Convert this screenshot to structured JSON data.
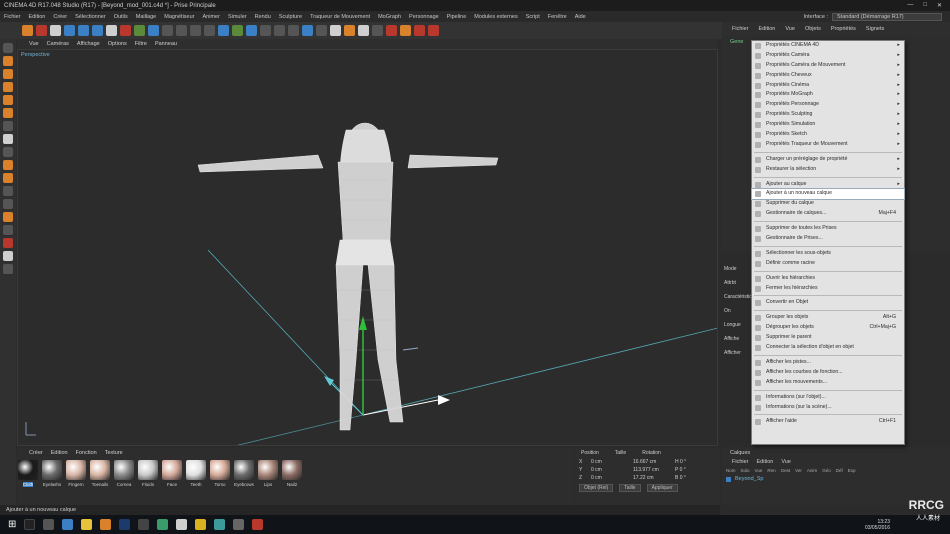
{
  "titlebar": {
    "title": "CINEMA 4D R17.048 Studio (R17) - [Beyond_mod_001.c4d *] - Prise Principale"
  },
  "menubar": {
    "items": [
      "Fichier",
      "Edition",
      "Créer",
      "Sélectionner",
      "Outils",
      "Maillage",
      "Magnétiseur",
      "Animer",
      "Simuler",
      "Rendu",
      "Sculpture",
      "Traqueur de Mouvement",
      "MoGraph",
      "Personnage",
      "Pipeline",
      "Modules externes",
      "Script",
      "Fenêtre",
      "Aide"
    ],
    "interface_label": "Interface :",
    "interface_value": "Standard (Démarrage R17)"
  },
  "viewport": {
    "menu": [
      "Vue",
      "Caméras",
      "Affichage",
      "Options",
      "Filtre",
      "Panneau"
    ],
    "label": "Perspective"
  },
  "materials": {
    "menu": [
      "Créer",
      "Edition",
      "Fonction",
      "Texture"
    ],
    "items": [
      {
        "label": "Cloth",
        "color": "#1a1a1a"
      },
      {
        "label": "Eyelashs",
        "color": "#6a6a6a"
      },
      {
        "label": "Fingern",
        "color": "#d8b6a6"
      },
      {
        "label": "Toenails",
        "color": "#d9b5a4"
      },
      {
        "label": "Cornea",
        "color": "#8a8a8a"
      },
      {
        "label": "Fluids",
        "color": "#c9c9c9"
      },
      {
        "label": "Face",
        "color": "#d4a89a"
      },
      {
        "label": "Teeth",
        "color": "#e0e0e0"
      },
      {
        "label": "Torso",
        "color": "#d6a998"
      },
      {
        "label": "Eyebrows",
        "color": "#6b6b6b"
      },
      {
        "label": "Lips",
        "color": "#a9877a"
      },
      {
        "label": "Nail2",
        "color": "#8c6b64"
      }
    ]
  },
  "coords": {
    "headers": [
      "Position",
      "Taille",
      "Rotation"
    ],
    "rows": [
      {
        "axis": "X",
        "pos": "0 cm",
        "size": "16.667 cm",
        "rot": "H 0 °"
      },
      {
        "axis": "Y",
        "pos": "0 cm",
        "size": "113.977 cm",
        "rot": "P 0 °"
      },
      {
        "axis": "Z",
        "pos": "0 cm",
        "size": "17.22 cm",
        "rot": "B 0 °"
      }
    ],
    "mode_select": "Objet (Rel)",
    "size_select": "Taille",
    "apply": "Appliquer"
  },
  "status": {
    "text": "Ajouter à un nouveau calque"
  },
  "rightpanel": {
    "menu": [
      "Fichier",
      "Edition",
      "Vue",
      "Objets",
      "Propriétés",
      "Signets"
    ],
    "object_name": "Gene",
    "layers_title": "Calques",
    "layers_menu": [
      "Fichier",
      "Edition",
      "Vue"
    ],
    "layers_cols": [
      "Nom",
      "Solo",
      "Vue",
      "Ren",
      "Gest",
      "Ver",
      "Anim",
      "Géo",
      "Déf",
      "Exp"
    ],
    "layer_item": "Beyond_Sp",
    "attr_labels": [
      "Mode",
      "Attrbt",
      "Caractéristiques",
      "On",
      "Longue",
      "Affiche",
      "Afficher"
    ]
  },
  "context_menu": {
    "items": [
      {
        "label": "Propriétés CINEMA 4D",
        "arrow": true
      },
      {
        "label": "Propriétés Caméra",
        "arrow": true
      },
      {
        "label": "Propriétés Caméra de Mouvement",
        "arrow": true
      },
      {
        "label": "Propriétés Cheveux",
        "arrow": true
      },
      {
        "label": "Propriétés Cinéma",
        "arrow": true
      },
      {
        "label": "Propriétés MoGraph",
        "arrow": true
      },
      {
        "label": "Propriétés Personnage",
        "arrow": true
      },
      {
        "label": "Propriétés Sculpting",
        "arrow": true
      },
      {
        "label": "Propriétés Simulation",
        "arrow": true
      },
      {
        "label": "Propriétés Sketch",
        "arrow": true
      },
      {
        "label": "Propriétés Traqueur de Mouvement",
        "arrow": true
      },
      {
        "sep": true
      },
      {
        "label": "Charger un préréglage de propriété",
        "arrow": true
      },
      {
        "label": "Restaurer la sélection",
        "arrow": true
      },
      {
        "sep": true
      },
      {
        "label": "Ajouter au calque",
        "arrow": true
      },
      {
        "label": "Ajouter à un nouveau calque",
        "highlight": true
      },
      {
        "label": "Supprimer du calque"
      },
      {
        "label": "Gestionnaire de calques...",
        "shortcut": "Maj+F4"
      },
      {
        "sep": true
      },
      {
        "label": "Supprimer de toutes les Prises"
      },
      {
        "label": "Gestionnaire de Prises..."
      },
      {
        "sep": true
      },
      {
        "label": "Sélectionner les sous-objets"
      },
      {
        "label": "Définir comme racine"
      },
      {
        "sep": true
      },
      {
        "label": "Ouvrir les hiérarchies"
      },
      {
        "label": "Fermer les hiérarchies"
      },
      {
        "sep": true
      },
      {
        "label": "Convertir en Objet"
      },
      {
        "sep": true
      },
      {
        "label": "Grouper les objets",
        "shortcut": "Alt+G"
      },
      {
        "label": "Dégrouper les objets",
        "shortcut": "Ctrl+Maj+G"
      },
      {
        "label": "Supprimer le parent"
      },
      {
        "label": "Connecter la sélection d'objet en objet"
      },
      {
        "sep": true
      },
      {
        "label": "Afficher les pistes..."
      },
      {
        "label": "Afficher les courbes de fonction..."
      },
      {
        "label": "Afficher les mouvements..."
      },
      {
        "sep": true
      },
      {
        "label": "Informations (sur l'objet)..."
      },
      {
        "label": "Informations (sur la scène)..."
      },
      {
        "sep": true
      },
      {
        "label": "Afficher l'aide",
        "shortcut": "Ctrl+F1"
      }
    ]
  },
  "taskbar": {
    "time": "13:23",
    "date": "03/05/2016"
  },
  "watermark": {
    "logo": "RRCG",
    "sub": "人人素材"
  }
}
